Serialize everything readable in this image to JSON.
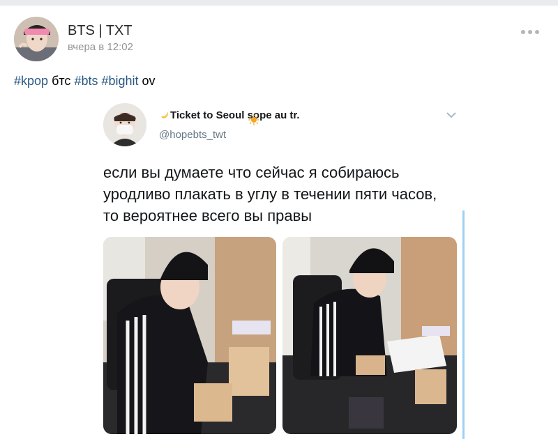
{
  "post": {
    "author": "BTS | TXT",
    "time": "вчера в 12:02",
    "hashtags": [
      "#kpop",
      "#bts",
      "#bighit"
    ],
    "words": [
      "бтс",
      "ov"
    ],
    "colors": {
      "link": "#2a5885",
      "meta": "#939393"
    }
  },
  "tweet": {
    "name": "Ticket to Seoul sope au tr.",
    "name_emojis": [
      "crescent-moon",
      "sun"
    ],
    "handle": "@hopebts_twt",
    "text_lines": [
      "если вы думаете что сейчас я собираюсь",
      "уродливо плакать в углу в течении пяти часов,",
      "то вероятнее всего вы правы"
    ],
    "photos": [
      "photo-1",
      "photo-2"
    ]
  },
  "icons": [
    "more-dots-icon",
    "chevron-down-icon",
    "moon-emoji-icon",
    "sun-emoji-icon"
  ]
}
